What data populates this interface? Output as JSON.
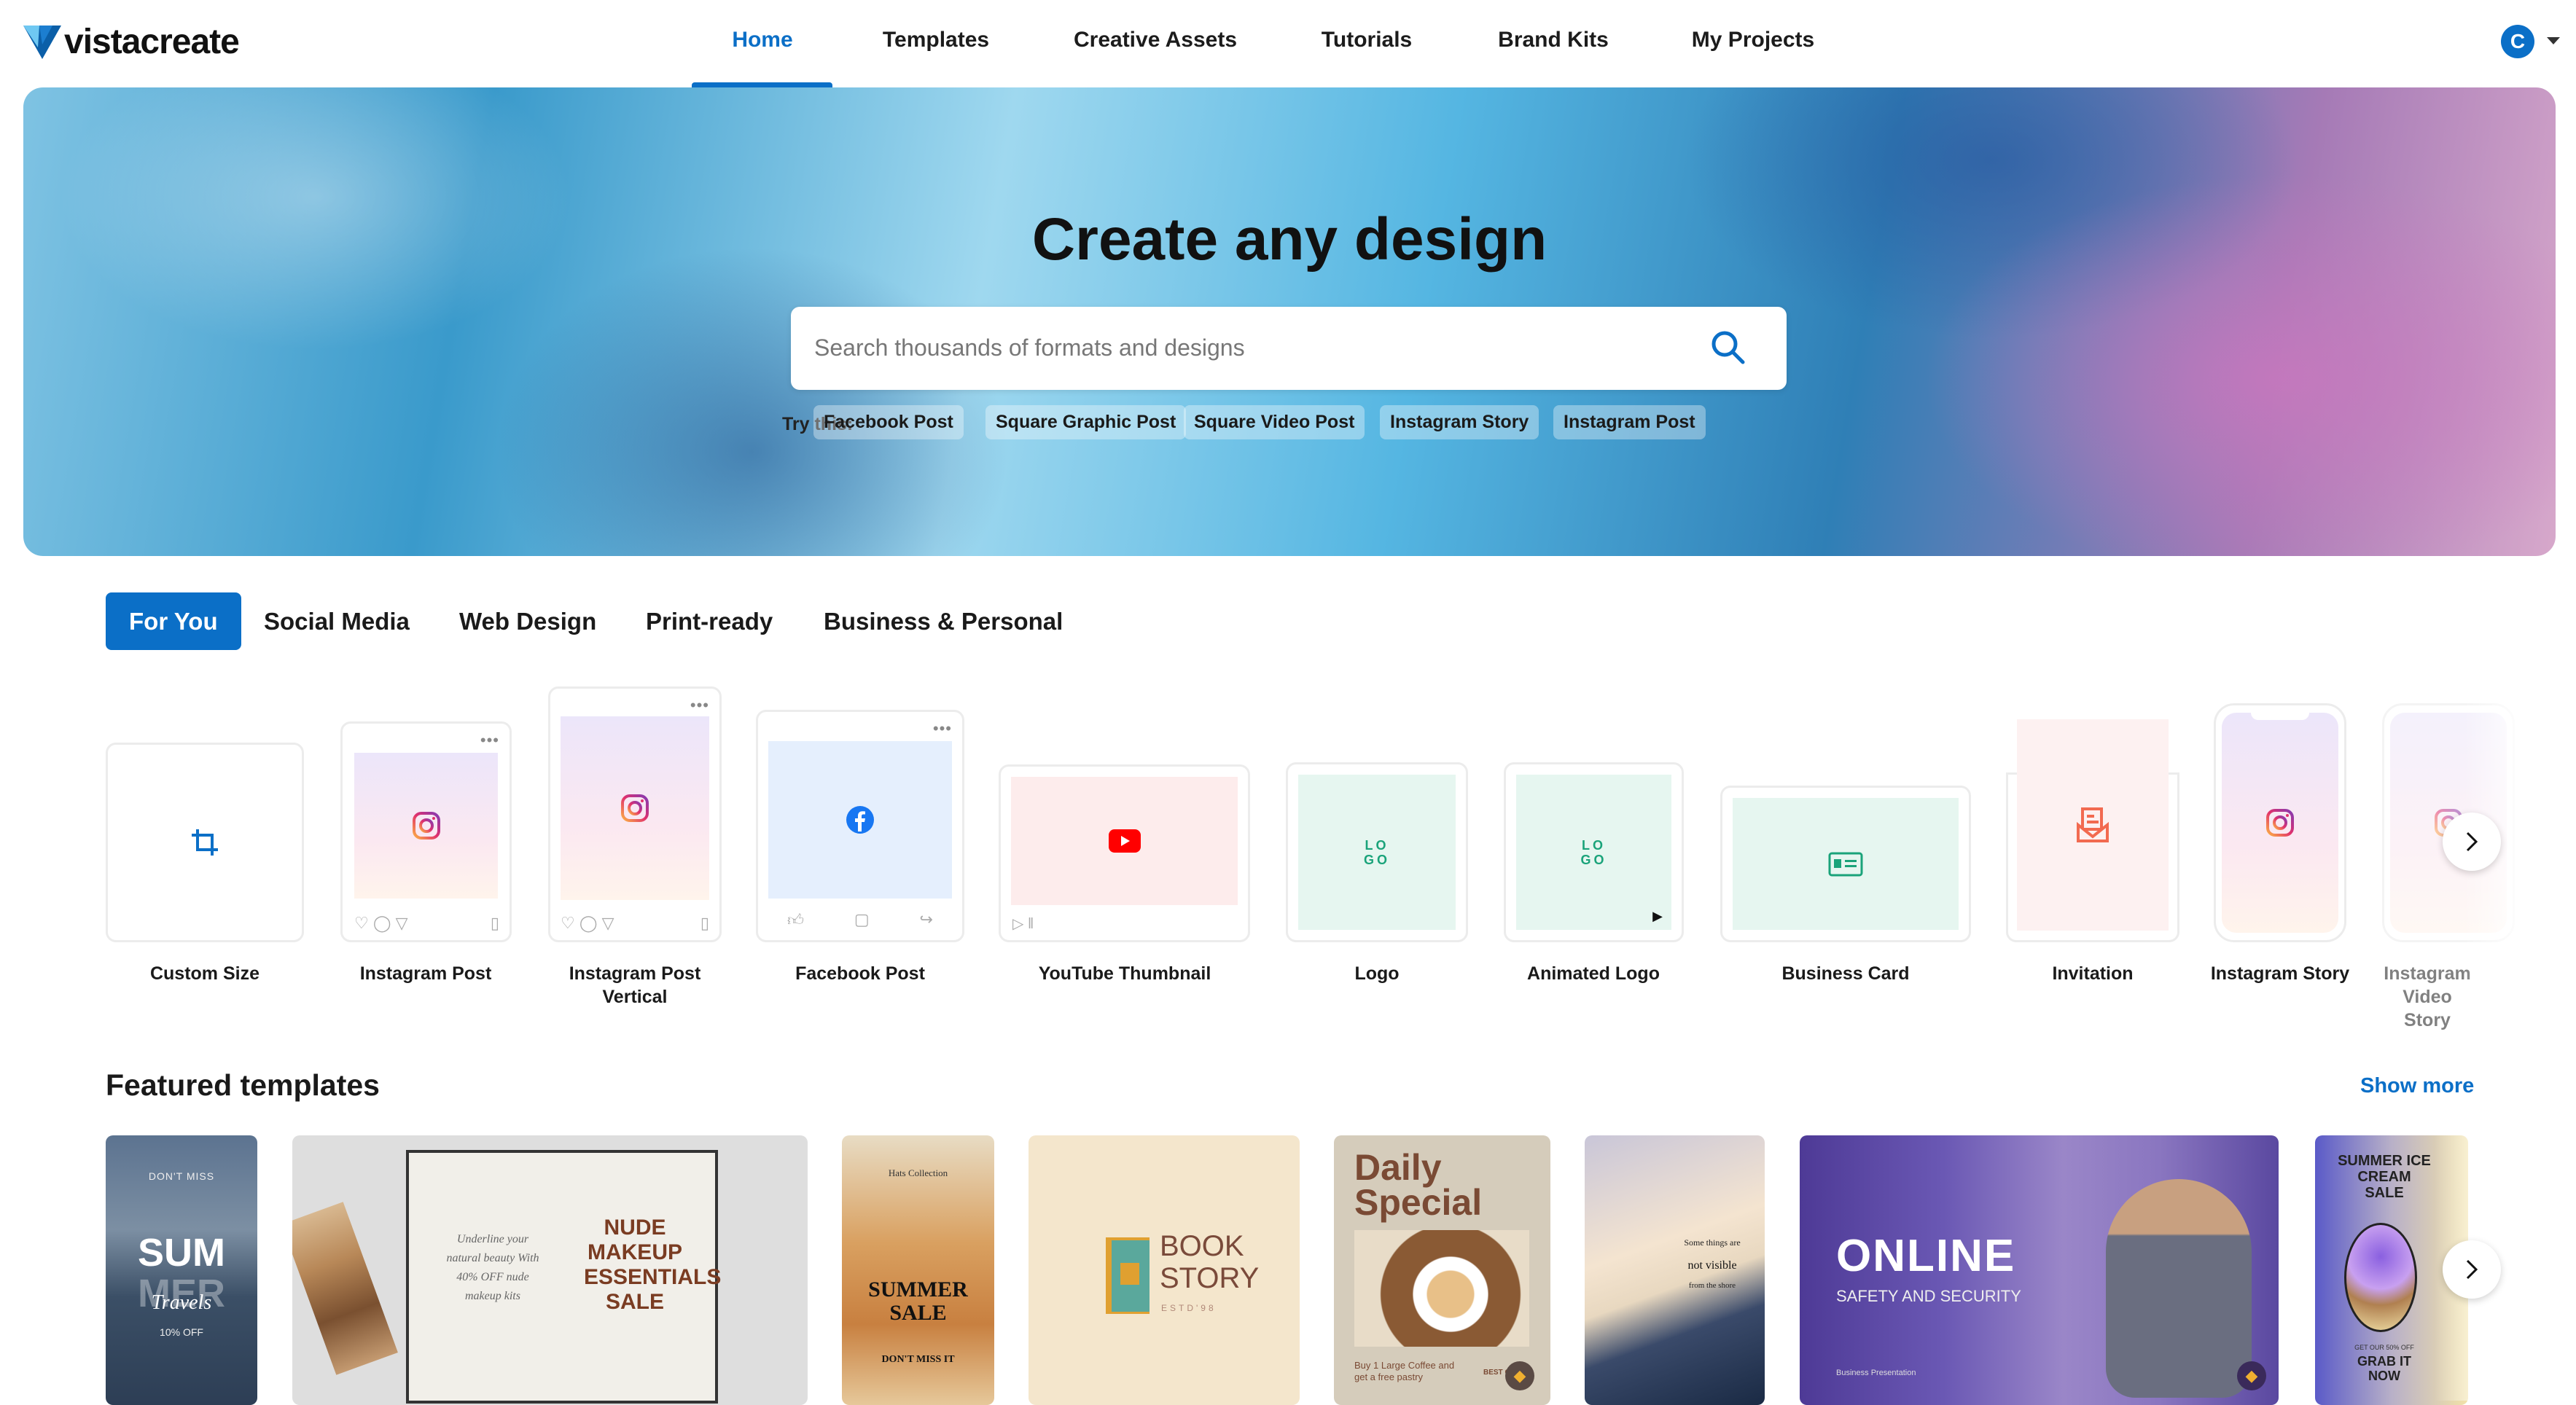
{
  "brand": {
    "name": "vistacreate",
    "accent": "#0b6fc7"
  },
  "nav": {
    "items": [
      "Home",
      "Templates",
      "Creative Assets",
      "Tutorials",
      "Brand Kits",
      "My Projects"
    ],
    "active": "Home",
    "avatar_letter": "C"
  },
  "hero": {
    "title": "Create any design",
    "search_placeholder": "Search thousands of formats and designs",
    "try_label": "Try this:",
    "suggestions": [
      "Facebook Post",
      "Square Graphic Post",
      "Square Video Post",
      "Instagram Story",
      "Instagram Post"
    ]
  },
  "tabs": [
    "For You",
    "Social Media",
    "Web Design",
    "Print-ready",
    "Business & Personal"
  ],
  "formats": [
    {
      "label": "Custom Size",
      "icon": "crop-icon"
    },
    {
      "label": "Instagram Post",
      "icon": "instagram-icon"
    },
    {
      "label": "Instagram Post Vertical",
      "icon": "instagram-icon"
    },
    {
      "label": "Facebook Post",
      "icon": "facebook-icon"
    },
    {
      "label": "YouTube Thumbnail",
      "icon": "youtube-icon"
    },
    {
      "label": "Logo",
      "icon": "logo-icon",
      "glyph": "LO GO"
    },
    {
      "label": "Animated Logo",
      "icon": "logo-icon",
      "glyph": "LO GO"
    },
    {
      "label": "Business Card",
      "icon": "id-card-icon"
    },
    {
      "label": "Invitation",
      "icon": "envelope-icon"
    },
    {
      "label": "Instagram Story",
      "icon": "instagram-icon"
    },
    {
      "label": "Instagram Video Story",
      "icon": "instagram-icon"
    }
  ],
  "featured": {
    "title": "Featured templates",
    "show_more": "Show more",
    "templates": [
      {
        "texts": [
          "DON'T MISS",
          "SUM",
          "MER",
          "Travels",
          "10% OFF"
        ]
      },
      {
        "texts": [
          "Underline your natural beauty With 40% OFF nude makeup kits",
          "NUDE MAKEUP ESSENTIALS SALE"
        ]
      },
      {
        "texts": [
          "Hats Collection",
          "SUMMER SALE",
          "DON'T MISS IT"
        ]
      },
      {
        "texts": [
          "BOOK STORY",
          "ESTD'98"
        ]
      },
      {
        "texts": [
          "Daily Special",
          "Buy 1 Large Coffee and get a free pastry",
          "BEST OF"
        ]
      },
      {
        "texts": [
          "Some things are",
          "not visible",
          "from the shore"
        ]
      },
      {
        "texts": [
          "ONLINE",
          "SAFETY AND SECURITY",
          "Business Presentation"
        ]
      },
      {
        "texts": [
          "SUMMER ICE CREAM SALE",
          "GET OUR 50% OFF",
          "GRAB IT NOW"
        ]
      }
    ]
  }
}
